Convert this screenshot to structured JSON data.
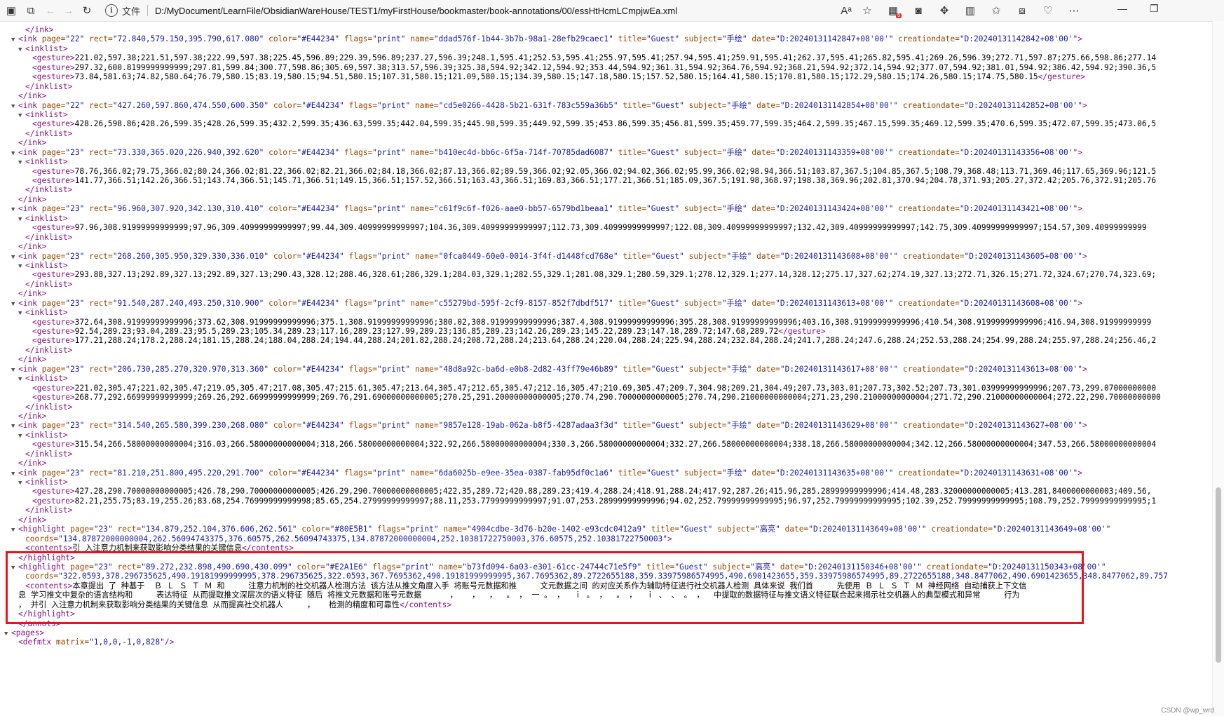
{
  "browser": {
    "scheme_label": "文件",
    "url": "D:/MyDocument/LearnFile/ObsidianWareHouse/TEST1/myFirstHouse/bookmaster/book-annotations/00/essHtHcmLCmpjwEa.xml",
    "badge": "5"
  },
  "xml_lines": [
    {
      "ind": 1,
      "t": "</ink>"
    },
    {
      "ind": 0,
      "tog": "▼",
      "t": "<ink page=\"22\" rect=\"72.840,579.150,395.790,617.080\" color=\"#E44234\" flags=\"print\" name=\"ddad576f-1b44-3b7b-98a1-28efb29caec1\" title=\"Guest\" subject=\"手绘\" date=\"D:20240131142847+08'00'\" creationdate=\"D:20240131142842+08'00'\">"
    },
    {
      "ind": 1,
      "tog": "▼",
      "t": "<inklist>"
    },
    {
      "ind": 2,
      "t": "<gesture>221.02,597.38;221.51,597.38;222.99,597.38;225.45,596.89;229.39,596.89;237.27,596.39;248.1,595.41;252.53,595.41;255.97,595.41;257.94,595.41;259.91,595.41;262.37,595.41;265.82,595.41;269.26,596.39;272.71,597.87;275.66,598.86;277.14"
    },
    {
      "ind": 2,
      "t": "<gesture>297.32,600.8199999999999;297.81,599.84;300.77,598.86;305.69,597.38;313.57,596.39;325.38,594.92;342.12,594.92;353.44,594.92;361.31,594.92;364.76,594.92;368.21,594.92;372.14,594.92;377.07,594.92;381.01,594.92;386.42,594.92;390.36,5"
    },
    {
      "ind": 2,
      "t": "<gesture>73.84,581.63;74.82,580.64;76.79,580.15;83.19,580.15;94.51,580.15;107.31,580.15;121.09,580.15;134.39,580.15;147.18,580.15;157.52,580.15;164.41,580.15;170.81,580.15;172.29,580.15;174.26,580.15;174.75,580.15</gesture>"
    },
    {
      "ind": 1,
      "t": "</inklist>"
    },
    {
      "ind": 0,
      "t": "</ink>"
    },
    {
      "ind": 0,
      "tog": "▼",
      "t": "<ink page=\"22\" rect=\"427.260,597.860,474.550,600.350\" color=\"#E44234\" flags=\"print\" name=\"cd5e0266-4428-5b21-631f-783c559a36b5\" title=\"Guest\" subject=\"手绘\" date=\"D:20240131142854+08'00'\" creationdate=\"D:20240131142852+08'00'\">"
    },
    {
      "ind": 1,
      "tog": "▼",
      "t": "<inklist>"
    },
    {
      "ind": 2,
      "t": "<gesture>428.26,598.86;428.26,599.35;428.26,599.35;432.2,599.35;436.63,599.35;442.04,599.35;445.98,599.35;449.92,599.35;453.86,599.35;456.81,599.35;459.77,599.35;464.2,599.35;467.15,599.35;469.12,599.35;470.6,599.35;472.07,599.35;473.06,5"
    },
    {
      "ind": 1,
      "t": "</inklist>"
    },
    {
      "ind": 0,
      "t": "</ink>"
    },
    {
      "ind": 0,
      "tog": "▼",
      "t": "<ink page=\"23\" rect=\"73.330,365.020,226.940,392.620\" color=\"#E44234\" flags=\"print\" name=\"b410ec4d-bb6c-6f5a-714f-70785dad6087\" title=\"Guest\" subject=\"手绘\" date=\"D:20240131143359+08'00'\" creationdate=\"D:20240131143356+08'00'\">"
    },
    {
      "ind": 1,
      "tog": "▼",
      "t": "<inklist>"
    },
    {
      "ind": 2,
      "t": "<gesture>78.76,366.02;79.75,366.02;80.24,366.02;81.22,366.02;82.21,366.02;84.18,366.02;87.13,366.02;89.59,366.02;92.05,366.02;94.02,366.02;95.99,366.02;98.94,366.51;103.87,367.5;104.85,367.5;108.79,368.48;113.71,369.46;117.65,369.96;121.5"
    },
    {
      "ind": 2,
      "t": "<gesture>141.77,366.51;142.26,366.51;143.74,366.51;145.71,366.51;149.15,366.51;157.52,366.51;163.43,366.51;169.83,366.51;177.21,366.51;185.09,367.5;191.98,368.97;198.38,369.96;202.81,370.94;204.78,371.93;205.27,372.42;205.76,372.91;205.76"
    },
    {
      "ind": 1,
      "t": "</inklist>"
    },
    {
      "ind": 0,
      "t": "</ink>"
    },
    {
      "ind": 0,
      "tog": "▼",
      "t": "<ink page=\"23\" rect=\"96.960,307.920,342.130,310.410\" color=\"#E44234\" flags=\"print\" name=\"c61f9c6f-f026-aae0-bb57-6579bd1beaa1\" title=\"Guest\" subject=\"手绘\" date=\"D:20240131143424+08'00'\" creationdate=\"D:20240131143421+08'00'\">"
    },
    {
      "ind": 1,
      "tog": "▼",
      "t": "<inklist>"
    },
    {
      "ind": 2,
      "t": "<gesture>97.96,308.91999999999999;97.96,309.40999999999997;99.44,309.40999999999997;104.36,309.40999999999997;112.73,309.40999999999997;122.08,309.40999999999997;132.42,309.40999999999997;142.75,309.40999999999997;154.57,309.40999999999"
    },
    {
      "ind": 1,
      "t": "</inklist>"
    },
    {
      "ind": 0,
      "t": "</ink>"
    },
    {
      "ind": 0,
      "tog": "▼",
      "t": "<ink page=\"23\" rect=\"268.260,305.950,329.330,336.010\" color=\"#E44234\" flags=\"print\" name=\"0fca0449-60e0-0014-3f4f-d1448fcd768e\" title=\"Guest\" subject=\"手绘\" date=\"D:20240131143608+08'00'\" creationdate=\"D:20240131143605+08'00'\">"
    },
    {
      "ind": 1,
      "tog": "▼",
      "t": "<inklist>"
    },
    {
      "ind": 2,
      "t": "<gesture>293.88,327.13;292.89,327.13;292.89,327.13;290.43,328.12;288.46,328.61;286,329.1;284.03,329.1;282.55,329.1;281.08,329.1;280.59,329.1;278.12,329.1;277.14,328.12;275.17,327.62;274.19,327.13;272.71,326.15;271.72,324.67;270.74,323.69;"
    },
    {
      "ind": 1,
      "t": "</inklist>"
    },
    {
      "ind": 0,
      "t": "</ink>"
    },
    {
      "ind": 0,
      "tog": "▼",
      "t": "<ink page=\"23\" rect=\"91.540,287.240,493.250,310.900\" color=\"#E44234\" flags=\"print\" name=\"c55279bd-595f-2cf9-8157-852f7dbdf517\" title=\"Guest\" subject=\"手绘\" date=\"D:20240131143613+08'00'\" creationdate=\"D:20240131143608+08'00'\">"
    },
    {
      "ind": 1,
      "tog": "▼",
      "t": "<inklist>"
    },
    {
      "ind": 2,
      "t": "<gesture>372.64,308.91999999999996;373.62,308.91999999999996;375.1,308.91999999999996;380.02,308.91999999999996;387.4,308.91999999999996;395.28,308.91999999999996;403.16,308.91999999999996;410.54,308.91999999999996;416.94,308.91999999999"
    },
    {
      "ind": 2,
      "t": "<gesture>92.54,289.23;93.04,289.23;95.5,289.23;105.34,289.23;117.16,289.23;127.99,289.23;136.85,289.23;142.26,289.23;145.22,289.23;147.18,289.72;147.68,289.72</gesture>"
    },
    {
      "ind": 2,
      "t": "<gesture>177.21,288.24;178.2,288.24;181.15,288.24;188.04,288.24;194.44,288.24;201.82,288.24;208.72,288.24;213.64,288.24;220.04,288.24;225.94,288.24;232.84,288.24;241.7,288.24;247.6,288.24;252.53,288.24;254.99,288.24;255.97,288.24;256.46,2"
    },
    {
      "ind": 1,
      "t": "</inklist>"
    },
    {
      "ind": 0,
      "t": "</ink>"
    },
    {
      "ind": 0,
      "tog": "▼",
      "t": "<ink page=\"23\" rect=\"206.730,285.270,320.970,313.360\" color=\"#E44234\" flags=\"print\" name=\"48d8a92c-ba6d-e0b8-2d82-43ff79e46b89\" title=\"Guest\" subject=\"手绘\" date=\"D:20240131143617+08'00'\" creationdate=\"D:20240131143613+08'00'\">"
    },
    {
      "ind": 1,
      "tog": "▼",
      "t": "<inklist>"
    },
    {
      "ind": 2,
      "t": "<gesture>221.02,305.47;221.02,305.47;219.05,305.47;217.08,305.47;215.61,305.47;213.64,305.47;212.65,305.47;212.16,305.47;210.69,305.47;209.7,304.98;209.21,304.49;207.73,303.01;207.73,302.52;207.73,301.03999999999996;207.73,299.07000000000"
    },
    {
      "ind": 2,
      "t": "<gesture>268.77,292.66999999999999;269.26,292.66999999999999;269.76,291.69000000000005;270.25,291.20000000000005;270.74,290.70000000000005;270.74,290.21000000000004;271.23,290.21000000000004;271.72,290.21000000000004;272.22,290.70000000000"
    },
    {
      "ind": 1,
      "t": "</inklist>"
    },
    {
      "ind": 0,
      "t": "</ink>"
    },
    {
      "ind": 0,
      "tog": "▼",
      "t": "<ink page=\"23\" rect=\"314.540,265.580,399.230,268.080\" color=\"#E44234\" flags=\"print\" name=\"9857e128-19ab-062a-b8f5-4287adaa3f3d\" title=\"Guest\" subject=\"手绘\" date=\"D:20240131143629+08'00'\" creationdate=\"D:20240131143627+08'00'\">"
    },
    {
      "ind": 1,
      "tog": "▼",
      "t": "<inklist>"
    },
    {
      "ind": 2,
      "t": "<gesture>315.54,266.58000000000004;316.03,266.58000000000004;318,266.58000000000004;322.92,266.58000000000004;330.3,266.58000000000004;332.27,266.58000000000004;338.18,266.58000000000004;342.12,266.58000000000004;347.53,266.58000000000004"
    },
    {
      "ind": 1,
      "t": "</inklist>"
    },
    {
      "ind": 0,
      "t": "</ink>"
    },
    {
      "ind": 0,
      "tog": "▼",
      "t": "<ink page=\"23\" rect=\"81.210,251.800,495.220,291.700\" color=\"#E44234\" flags=\"print\" name=\"6da6025b-e9ee-35ea-0387-fab95df0c1a6\" title=\"Guest\" subject=\"手绘\" date=\"D:20240131143635+08'00'\" creationdate=\"D:20240131143631+08'00'\">"
    },
    {
      "ind": 1,
      "tog": "▼",
      "t": "<inklist>"
    },
    {
      "ind": 2,
      "t": "<gesture>427.28,290.70000000000005;426.78,290.70000000000005;426.29,290.70000000000005;422.35,289.72;420.88,289.23;419.4,288.24;418.91,288.24;417.92,287.26;415.96,285.28999999999996;414.48,283.32000000000005;413.281,8400000000003;409.56,"
    },
    {
      "ind": 2,
      "t": "<gesture>82.21,255.75;83.19,255.26;83.68,254.76999999999998;85.65,254.27999999999997;88.11,253.77999999999997;91.07,253.28999999999996;94.02,252.79999999999995;96.97,252.79999999999995;102.39,252.79999999999995;108.79,252.79999999999995;1"
    },
    {
      "ind": 1,
      "t": "</inklist>"
    },
    {
      "ind": 0,
      "t": "</ink>"
    },
    {
      "ind": 0,
      "tog": "▼",
      "t": "<highlight page=\"23\" rect=\"134.879,252.104,376.606,262.561\" color=\"#80E5B1\" flags=\"print\" name=\"4904cdbe-3d76-b20e-1402-e93cdc0412a9\" title=\"Guest\" subject=\"高亮\" date=\"D:20240131143649+08'00'\" creationdate=\"D:20240131143649+08'00'\""
    },
    {
      "ind": 1,
      "t": "coords=\"134.87872000000004,262.56094743375,376.60575,262.56094743375,134.87872000000004,252.10381722750003,376.60575,252.10381722750003\">"
    },
    {
      "ind": 1,
      "t": "<contents>引 入注意力机制来获取影响分类结果的关键信息</contents>"
    },
    {
      "ind": 0,
      "t": "</highlight>"
    },
    {
      "ind": 0,
      "tog": "▼",
      "t": "<highlight page=\"23\" rect=\"89.272,232.898,490.690,430.099\" color=\"#E2A1E6\" flags=\"print\" name=\"b73fd094-6a03-e301-61cc-24744c71e5f9\" title=\"Guest\" subject=\"高亮\" date=\"D:20240131150346+08'00'\" creationdate=\"D:20240131150343+08'00'\""
    },
    {
      "ind": 1,
      "t": "coords=\"322.0593,378.296735625,490.19181999999995,378.296735625,322.0593,367.7695362,490.19181999999995,367.7695362,89.2722655188,359.33975986574995,490.6901423655,359.33975986574995,89.2722655188,348.8477062,490.6901423655,348.8477062,89.757"
    },
    {
      "ind": 1,
      "t": "<contents>本章提出 了 种基于  Ｂ Ｌ Ｓ Ｔ Ｍ 和     注意力机制的社交机器人检测方法 该方法从推文角度入手 将账号元数据和推     文元数据之间 的对应关系作为辅助特征进行社交机器人检测 具体来说 我们首     先使用 Ｂ Ｌ Ｓ Ｔ Ｍ 神经网络 自动捕获上下文信"
    },
    {
      "ind": 0,
      "t": "息 学习推文中复杂的语言结构和     表达特征 从而提取推文深层次的语义特征 随后 将推文元数据和账号元数据      ，   ，  ，  。 ， 一 。 ，  ｉ 。 ，  。 ，  ｉ 、 、 。 ，  中提取的数据特征与推文语义特征联合起来揭示社交机器人的典型模式和异常     行为"
    },
    {
      "ind": 0,
      "t": "， 并引 入注意力机制来获取影响分类结果的关键信息 从而提高社交机器人     ，   检测的精度和可靠性</contents>"
    },
    {
      "ind": 0,
      "t": "</highlight>"
    },
    {
      "ind": 0,
      "t": "</annots>"
    },
    {
      "ind": -1,
      "tog": "▼",
      "t": "<pages>"
    },
    {
      "ind": 0,
      "t": "<defmtx matrix=\"1,0,0,-1,0,828\"/>"
    }
  ],
  "watermark": "CSDN @wp_wrd"
}
